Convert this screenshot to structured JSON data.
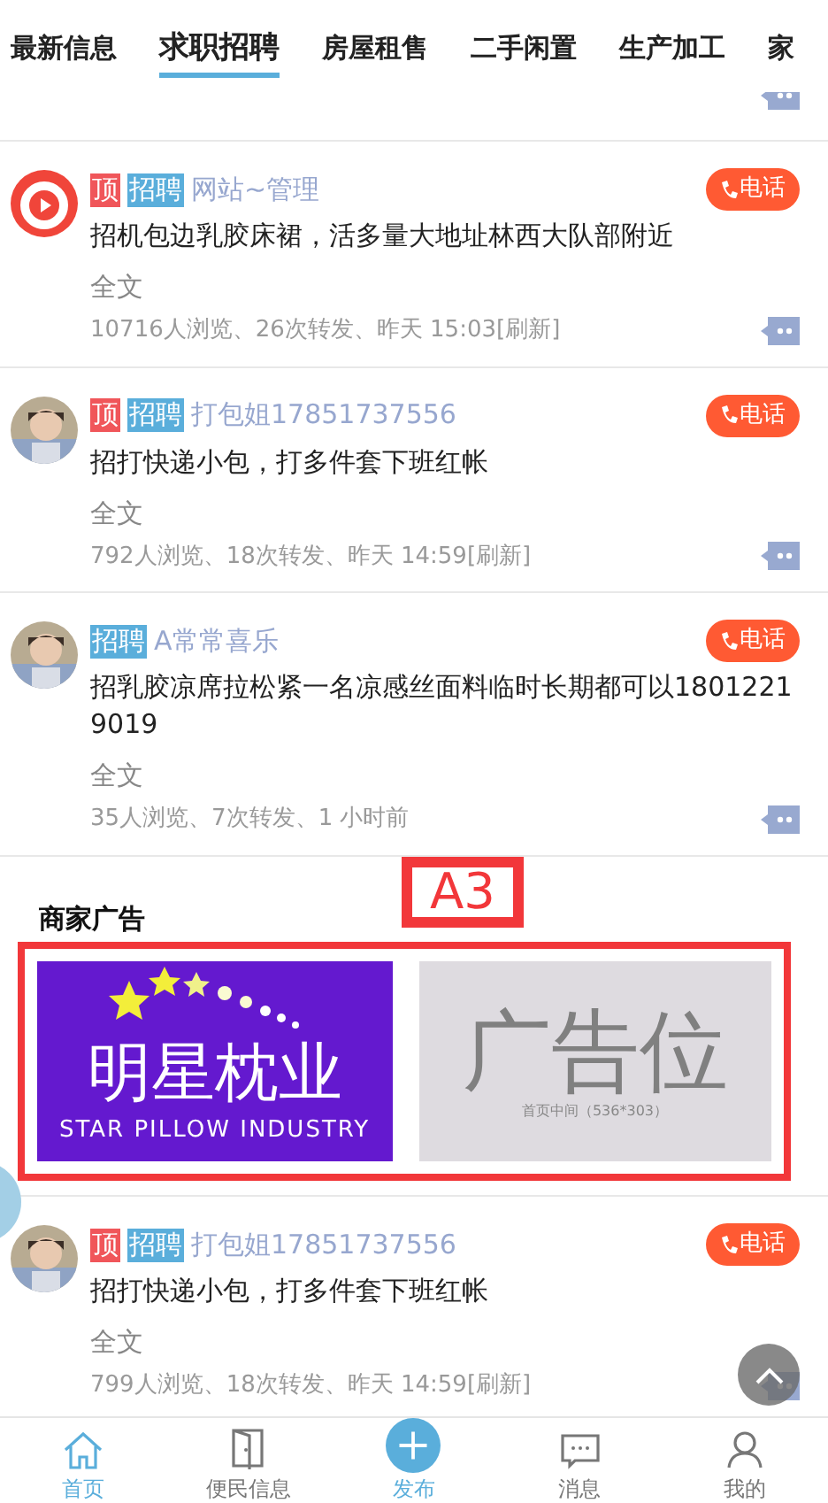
{
  "tabs": [
    {
      "label": "最新信息",
      "selected": false
    },
    {
      "label": "求职招聘",
      "selected": true
    },
    {
      "label": "房屋租售",
      "selected": false
    },
    {
      "label": "二手闲置",
      "selected": false
    },
    {
      "label": "生产加工",
      "selected": false
    },
    {
      "label": "家",
      "selected": false
    }
  ],
  "posts": [
    {
      "kind": "logo",
      "top_tag": "顶",
      "tag": "招聘",
      "name": "网站~管理",
      "phone": "电话",
      "content": "招机包边乳胶床裙，活多量大地址林西大队部附近",
      "more": "全文",
      "stats": "10716人浏览、26次转发、昨天 15:03[刷新]"
    },
    {
      "top_tag": "顶",
      "tag": "招聘",
      "name": "打包姐17851737556",
      "phone": "电话",
      "content": "招打快递小包，打多件套下班红帐",
      "more": "全文",
      "stats": "792人浏览、18次转发、昨天 14:59[刷新]"
    },
    {
      "tag": "招聘",
      "name": "A常常喜乐",
      "phone": "电话",
      "content": "招乳胶凉席拉松紧一名凉感丝面料临时长期都可以18012219019",
      "more": "全文",
      "stats": "35人浏览、7次转发、1 小时前"
    }
  ],
  "ads": {
    "title": "商家广告",
    "marker": "A3",
    "banners": [
      {
        "kind": "brand",
        "title": "明星枕业",
        "subtitle": "STAR PILLOW INDUSTRY"
      },
      {
        "kind": "placeholder",
        "title": "广告位",
        "subtitle": "首页中间（536*303）"
      }
    ]
  },
  "posts_after": [
    {
      "top_tag": "顶",
      "tag": "招聘",
      "name": "打包姐17851737556",
      "phone": "电话",
      "content": "招打快递小包，打多件套下班红帐",
      "more": "全文",
      "stats": "799人浏览、18次转发、昨天 14:59[刷新]"
    }
  ],
  "nav": [
    {
      "label": "首页",
      "selected": true
    },
    {
      "label": "便民信息",
      "selected": false
    },
    {
      "label": "发布",
      "selected": true
    },
    {
      "label": "消息",
      "selected": false
    },
    {
      "label": "我的",
      "selected": false
    }
  ]
}
